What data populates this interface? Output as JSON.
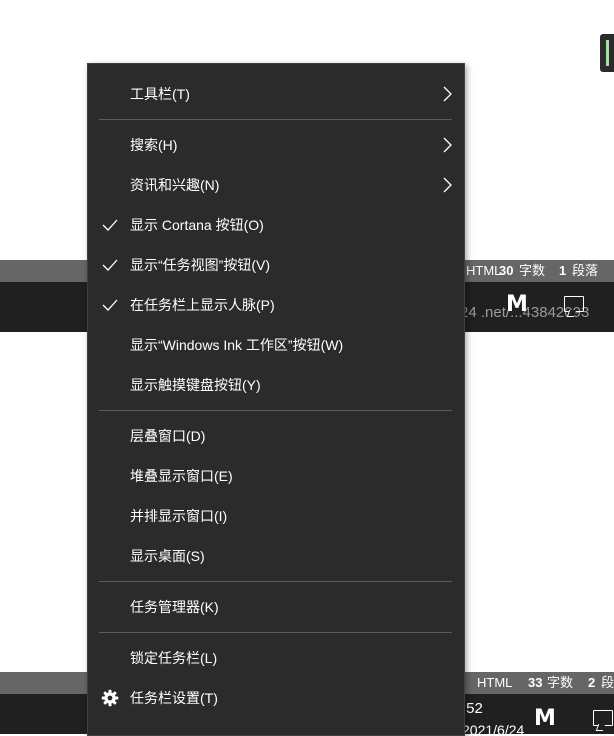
{
  "background": {
    "status_bar_1": {
      "format": "HTML",
      "word_count": "30",
      "word_unit": "字数",
      "para_count": "1",
      "para_unit": "段落"
    },
    "status_bar_2": {
      "format": "HTML",
      "word_count": "33",
      "word_unit": "字数",
      "para_count": "2",
      "para_unit": "段"
    },
    "band_1": {
      "url_fragment": "24 .net/...43842093"
    },
    "band_2": {
      "time_fragment": ":52",
      "date_fragment": "2021/6/24"
    }
  },
  "context_menu": {
    "toolbars": "工具栏(T)",
    "search": "搜索(H)",
    "news_interests": "资讯和兴趣(N)",
    "show_cortana": "显示 Cortana 按钮(O)",
    "show_task_view": "显示“任务视图”按钮(V)",
    "show_people": "在任务栏上显示人脉(P)",
    "show_ink": "显示“Windows Ink 工作区”按钮(W)",
    "show_touch_keyboard": "显示触摸键盘按钮(Y)",
    "cascade": "层叠窗口(D)",
    "stacked": "堆叠显示窗口(E)",
    "side_by_side": "并排显示窗口(I)",
    "show_desktop": "显示桌面(S)",
    "task_manager": "任务管理器(K)",
    "lock_taskbar": "锁定任务栏(L)",
    "taskbar_settings": "任务栏设置(T)"
  },
  "icons": {
    "checkmark": "check-icon",
    "submenu": "chevron-right-icon",
    "settings": "gear-icon"
  },
  "colors": {
    "menu_bg": "#2b2b2b",
    "menu_text": "#ffffff",
    "separator": "#5c5c5c",
    "status_strip": "#666666",
    "taskbar": "#202020"
  }
}
